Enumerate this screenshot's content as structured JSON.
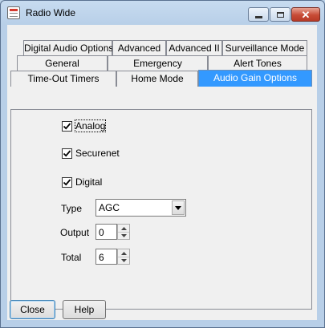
{
  "window": {
    "title": "Radio Wide",
    "icon": "app-document-icon",
    "controls": {
      "minimize": "minimize-icon",
      "maximize": "maximize-icon",
      "close": "close-icon"
    }
  },
  "tabs": {
    "row1": [
      "Digital Audio Options",
      "Advanced",
      "Advanced II",
      "Surveillance Mode"
    ],
    "row2": [
      "General",
      "Emergency",
      "Alert Tones"
    ],
    "row3": [
      "Time-Out Timers",
      "Home Mode",
      "Audio Gain Options"
    ],
    "active": "Audio Gain Options"
  },
  "audio_gain": {
    "analog": {
      "label": "Analog",
      "checked": true
    },
    "securenet": {
      "label": "Securenet",
      "checked": true
    },
    "digital": {
      "label": "Digital",
      "checked": true
    },
    "type": {
      "label": "Type",
      "value": "AGC"
    },
    "output": {
      "label": "Output",
      "value": "0"
    },
    "total": {
      "label": "Total",
      "value": "6"
    }
  },
  "buttons": {
    "close": "Close",
    "help": "Help"
  },
  "colors": {
    "active_tab": "#3399ff",
    "window_frame": "#b8cfe8",
    "close_button": "#c74b36"
  }
}
